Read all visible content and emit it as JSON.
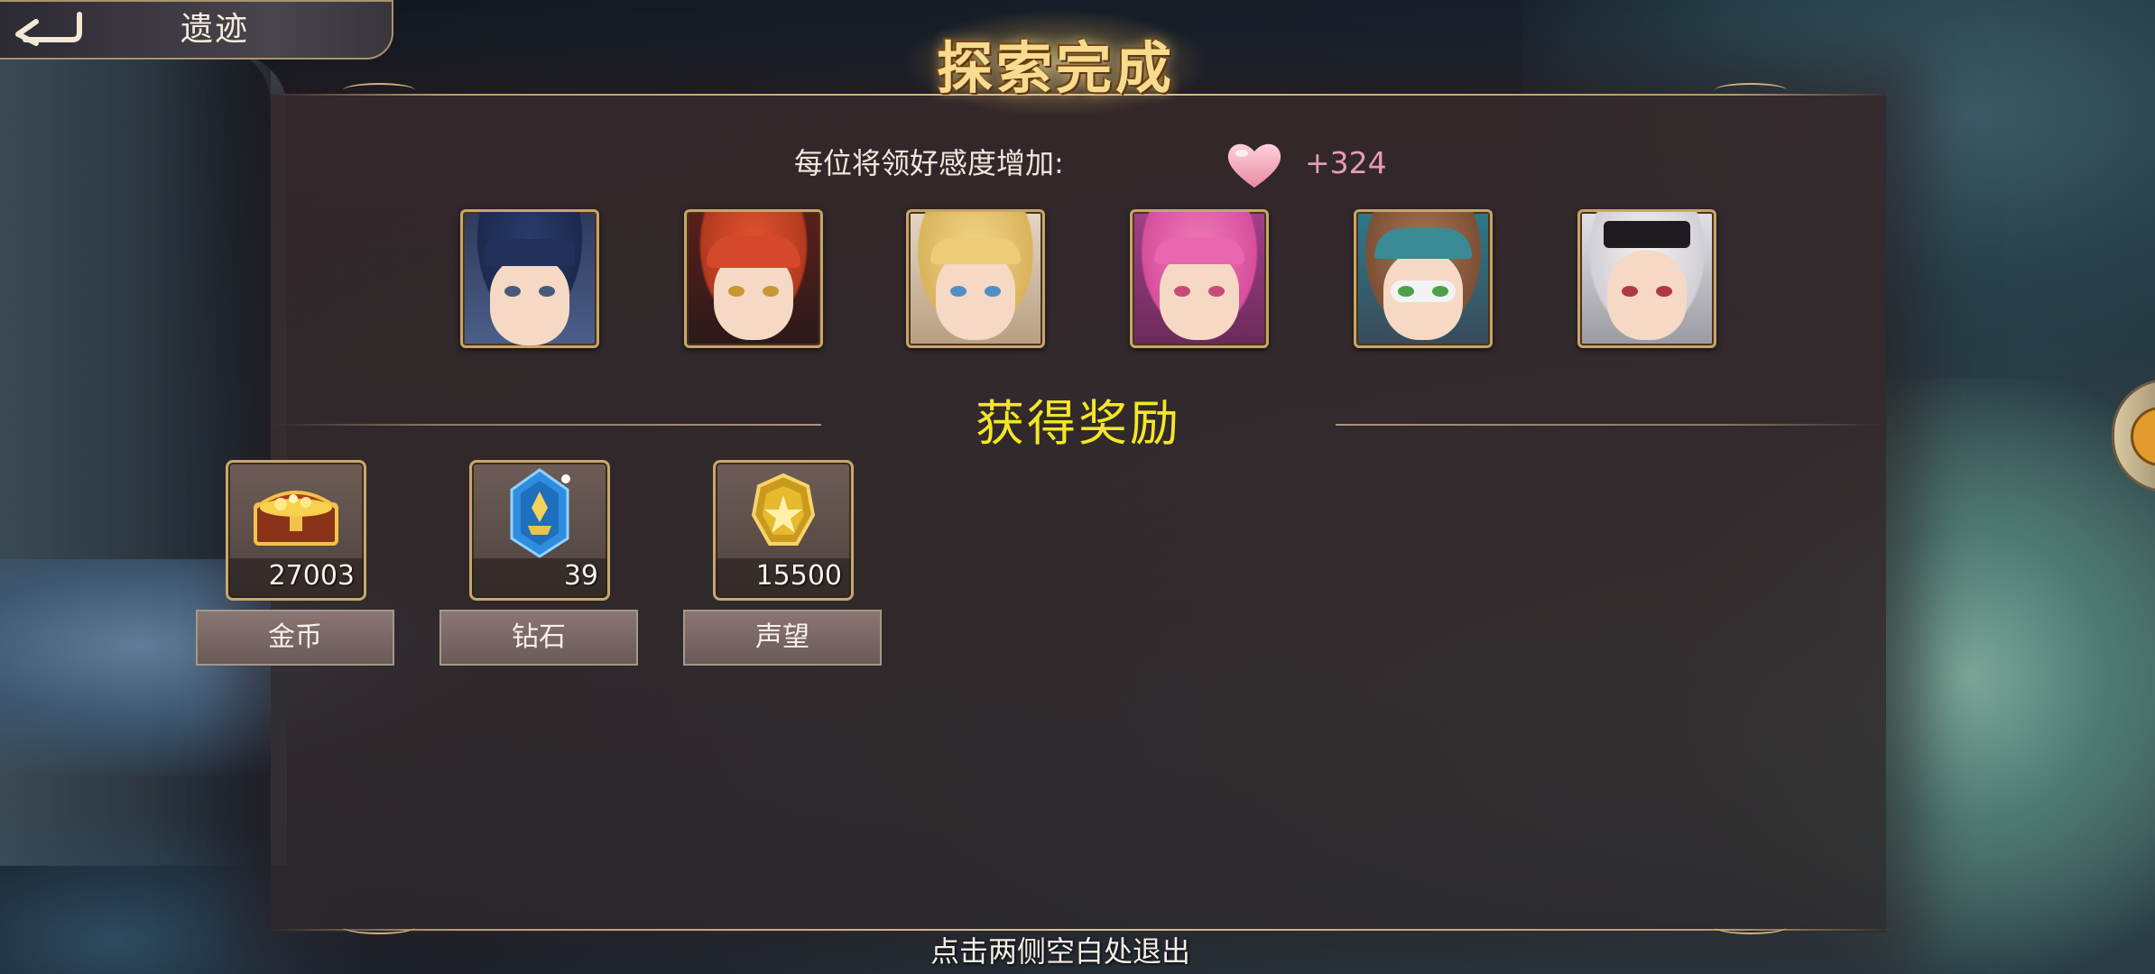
{
  "header": {
    "back_title": "遗迹"
  },
  "title": "探索完成",
  "affection": {
    "label": "每位将领好感度增加:",
    "value": "+324",
    "icon": "heart-icon"
  },
  "portraits": [
    {
      "name": "portrait-1",
      "icon": "character-portrait-icon"
    },
    {
      "name": "portrait-2",
      "icon": "character-portrait-icon"
    },
    {
      "name": "portrait-3",
      "icon": "character-portrait-icon"
    },
    {
      "name": "portrait-4",
      "icon": "character-portrait-icon"
    },
    {
      "name": "portrait-5",
      "icon": "character-portrait-icon"
    },
    {
      "name": "portrait-6",
      "icon": "character-portrait-icon"
    }
  ],
  "rewards_heading": "获得奖励",
  "rewards": [
    {
      "label": "金币",
      "count": "27003",
      "icon": "treasure-chest-icon"
    },
    {
      "label": "钻石",
      "count": "39",
      "icon": "crystal-icon"
    },
    {
      "label": "声望",
      "count": "15500",
      "icon": "gold-badge-icon"
    }
  ],
  "exit_hint": "点击两侧空白处退出",
  "colors": {
    "title": "#f7dc8f",
    "rewards_heading": "#f2e726",
    "affection_value": "#e79bb4",
    "frame_gold": "#c9a46a"
  }
}
